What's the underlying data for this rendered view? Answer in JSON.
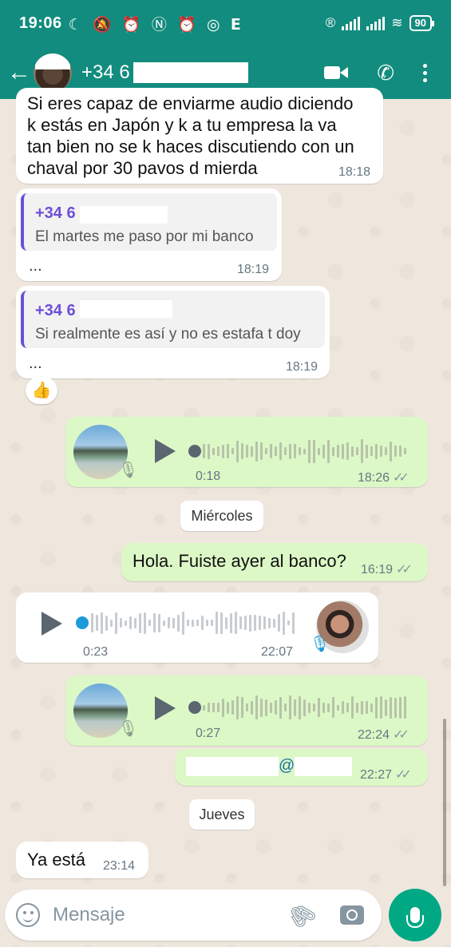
{
  "status_bar": {
    "time": "19:06",
    "left_icons": [
      "moon-icon",
      "bell-off-icon",
      "alarm-icon",
      "nfc-icon",
      "alarm-icon",
      "instagram-icon",
      "e-icon"
    ],
    "battery": "90"
  },
  "header": {
    "contact_name": "+34 6",
    "icons": [
      "back-arrow-icon",
      "video-call-icon",
      "phone-icon",
      "more-vert-icon"
    ]
  },
  "messages": {
    "m1": {
      "text_lines": [
        "Si eres capaz de enviarme audio diciendo",
        "k estás en Japón y k a tu empresa la va",
        "tan bien no se k haces discutiendo con un",
        "chaval por 30 pavos d mierda"
      ],
      "time": "18:18"
    },
    "m2": {
      "quote_author": "+34 6",
      "quote_text": "El martes me paso por mi banco",
      "ellipsis": "...",
      "time": "18:19"
    },
    "m3": {
      "quote_author": "+34 6",
      "quote_text": "Si realmente es así y no es estafa t doy",
      "ellipsis": "...",
      "time": "18:19",
      "reaction": "👍"
    },
    "m4": {
      "duration": "0:18",
      "time": "18:26",
      "ticks": "✓✓"
    },
    "date1": "Miércoles",
    "m5": {
      "text": "Hola. Fuiste ayer al banco?",
      "time": "16:19",
      "ticks": "✓✓"
    },
    "m6": {
      "duration": "0:23",
      "time": "22:07"
    },
    "m7": {
      "duration": "0:27",
      "time": "22:24",
      "ticks": "✓✓"
    },
    "m8": {
      "text": "@",
      "time": "22:27",
      "ticks": "✓✓"
    },
    "date2": "Jueves",
    "m9": {
      "text": "Ya está",
      "time": "23:14"
    }
  },
  "composer": {
    "placeholder": "Mensaje"
  },
  "colors": {
    "header": "#128c7e",
    "outgoing": "#dcf8c6",
    "incoming": "#ffffff",
    "accent": "#00a884",
    "quote_bar": "#6b4fd8"
  }
}
